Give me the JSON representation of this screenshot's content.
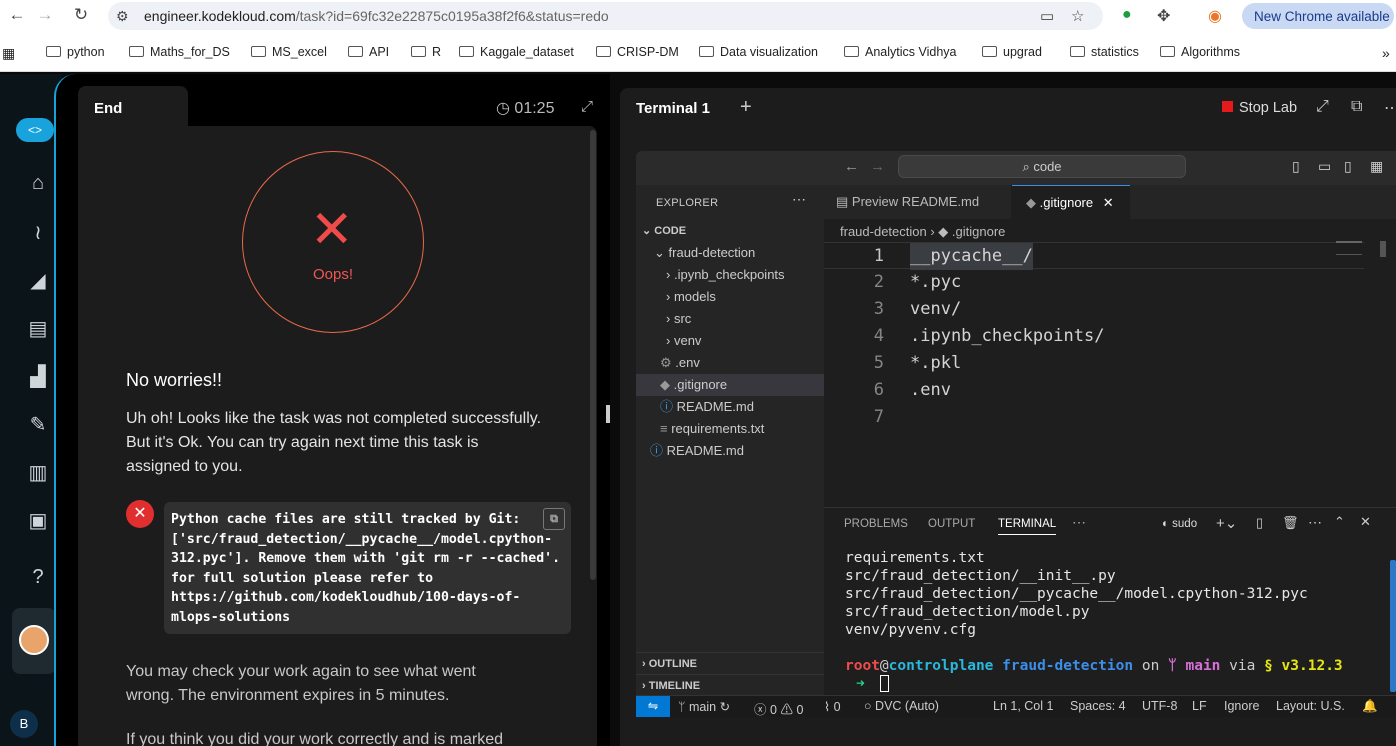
{
  "browser": {
    "url_host": "engineer.kodekloud.com",
    "url_path": "/task?id=69fc32e22875c0195a38f2f6&status=redo",
    "new_chrome_label": "New Chrome available",
    "bookmarks": [
      "python",
      "Maths_for_DS",
      "MS_excel",
      "API",
      "R",
      "Kaggale_dataset",
      "CRISP-DM",
      "Data visualization",
      "Analytics Vidhya",
      "upgrad",
      "statistics",
      "Algorithms"
    ]
  },
  "sidebar": {
    "user_initial": "B"
  },
  "task_panel": {
    "tab_label": "End",
    "timer": "01:25",
    "oops_label": "Oops!",
    "heading": "No worries!!",
    "message": "Uh oh! Looks like the task was not completed successfully. But it's Ok. You can try again next time this task is assigned to you.",
    "error_text": "Python cache files are still tracked by Git: ['src/fraud_detection/__pycache__/model.cpython-312.pyc']. Remove them with 'git rm -r --cached'. for full solution please refer to https://github.com/kodekloudhub/100-days-of-mlops-solutions",
    "recheck_text": "You may check your work again to see what went wrong. The environment expires in 5 minutes.",
    "footer_text": "If you think you did your work correctly and is marked"
  },
  "terminal_panel": {
    "tab_label": "Terminal 1",
    "stop_lab_label": "Stop Lab"
  },
  "vscode": {
    "search_label": "code",
    "explorer_title": "EXPLORER",
    "root_folder": "CODE",
    "tree": [
      {
        "label": "fraud-detection",
        "type": "folder-open"
      },
      {
        "label": ".ipynb_checkpoints",
        "type": "folder"
      },
      {
        "label": "models",
        "type": "folder"
      },
      {
        "label": "src",
        "type": "folder"
      },
      {
        "label": "venv",
        "type": "folder"
      },
      {
        "label": ".env",
        "type": "file-gear"
      },
      {
        "label": ".gitignore",
        "type": "file-git"
      },
      {
        "label": "README.md",
        "type": "file-info"
      },
      {
        "label": "requirements.txt",
        "type": "file-text"
      },
      {
        "label": "README.md",
        "type": "file-info"
      }
    ],
    "outline_label": "OUTLINE",
    "timeline_label": "TIMELINE",
    "tabs": [
      {
        "label": "Preview README.md"
      },
      {
        "label": ".gitignore"
      }
    ],
    "breadcrumb": [
      "fraud-detection",
      ".gitignore"
    ],
    "code_lines": [
      {
        "num": "1",
        "text": "__pycache__/"
      },
      {
        "num": "2",
        "text": "*.pyc"
      },
      {
        "num": "3",
        "text": "venv/"
      },
      {
        "num": "4",
        "text": ".ipynb_checkpoints/"
      },
      {
        "num": "5",
        "text": "*.pkl"
      },
      {
        "num": "6",
        "text": ".env"
      },
      {
        "num": "7",
        "text": ""
      }
    ],
    "panel_tabs": [
      "PROBLEMS",
      "OUTPUT",
      "TERMINAL"
    ],
    "panel_shell": "sudo",
    "terminal_lines": [
      "requirements.txt",
      "src/fraud_detection/__init__.py",
      "src/fraud_detection/__pycache__/model.cpython-312.pyc",
      "src/fraud_detection/model.py",
      "venv/pyvenv.cfg"
    ],
    "prompt": {
      "user": "root",
      "host": "controlplane",
      "dir": "fraud-detection",
      "on": "on",
      "branch": "main",
      "via": "via",
      "version": "v3.12.3"
    },
    "status": {
      "branch": "main",
      "errors": "0",
      "warnings": "0",
      "ports": "0",
      "dvc": "DVC (Auto)",
      "position": "Ln 1, Col 1",
      "spaces": "Spaces: 4",
      "encoding": "UTF-8",
      "eol": "LF",
      "ignore": "Ignore",
      "layout": "Layout: U.S."
    }
  }
}
